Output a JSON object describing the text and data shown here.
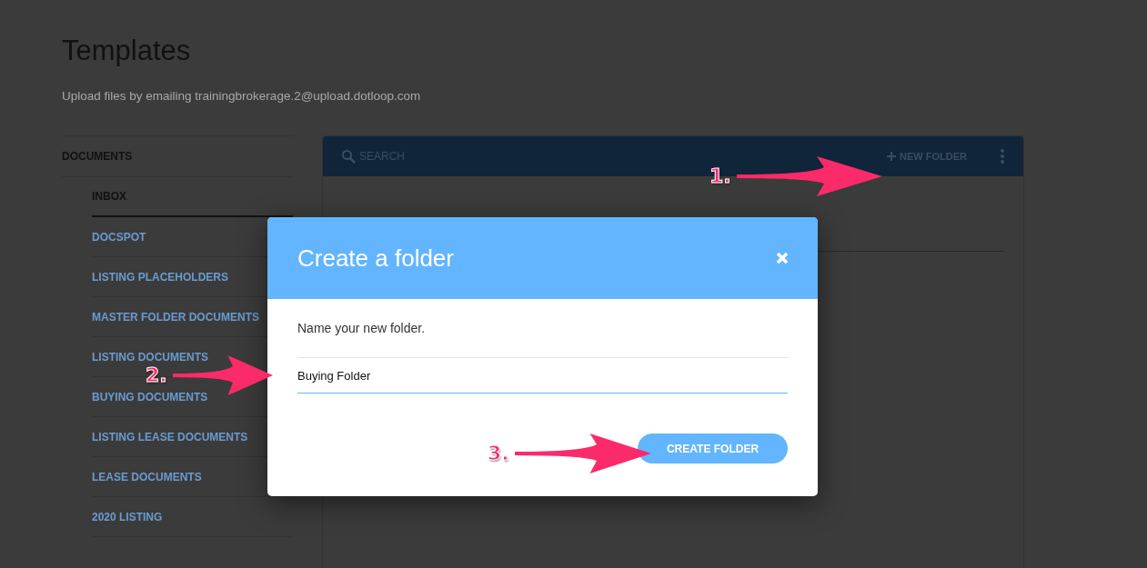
{
  "page": {
    "title": "Templates",
    "subtitle": "Upload files by emailing trainingbrokerage.2@upload.dotloop.com"
  },
  "sidebar": {
    "heading": "DOCUMENTS",
    "items": [
      {
        "label": "INBOX",
        "selected": true
      },
      {
        "label": "DOCSPOT",
        "selected": false
      },
      {
        "label": "LISTING PLACEHOLDERS",
        "selected": false
      },
      {
        "label": "MASTER FOLDER DOCUMENTS",
        "selected": false
      },
      {
        "label": "LISTING DOCUMENTS",
        "selected": false
      },
      {
        "label": "BUYING DOCUMENTS",
        "selected": false
      },
      {
        "label": "LISTING LEASE DOCUMENTS",
        "selected": false
      },
      {
        "label": "LEASE DOCUMENTS",
        "selected": false
      },
      {
        "label": "2020 LISTING",
        "selected": false
      }
    ]
  },
  "toolbar": {
    "search_placeholder": "SEARCH",
    "new_folder": "NEW FOLDER"
  },
  "dialog": {
    "title": "Create a folder",
    "prompt": "Name your new folder.",
    "value": "Buying Folder",
    "button": "CREATE FOLDER"
  },
  "annotations": [
    {
      "label": "1."
    },
    {
      "label": "2."
    },
    {
      "label": "3."
    }
  ]
}
